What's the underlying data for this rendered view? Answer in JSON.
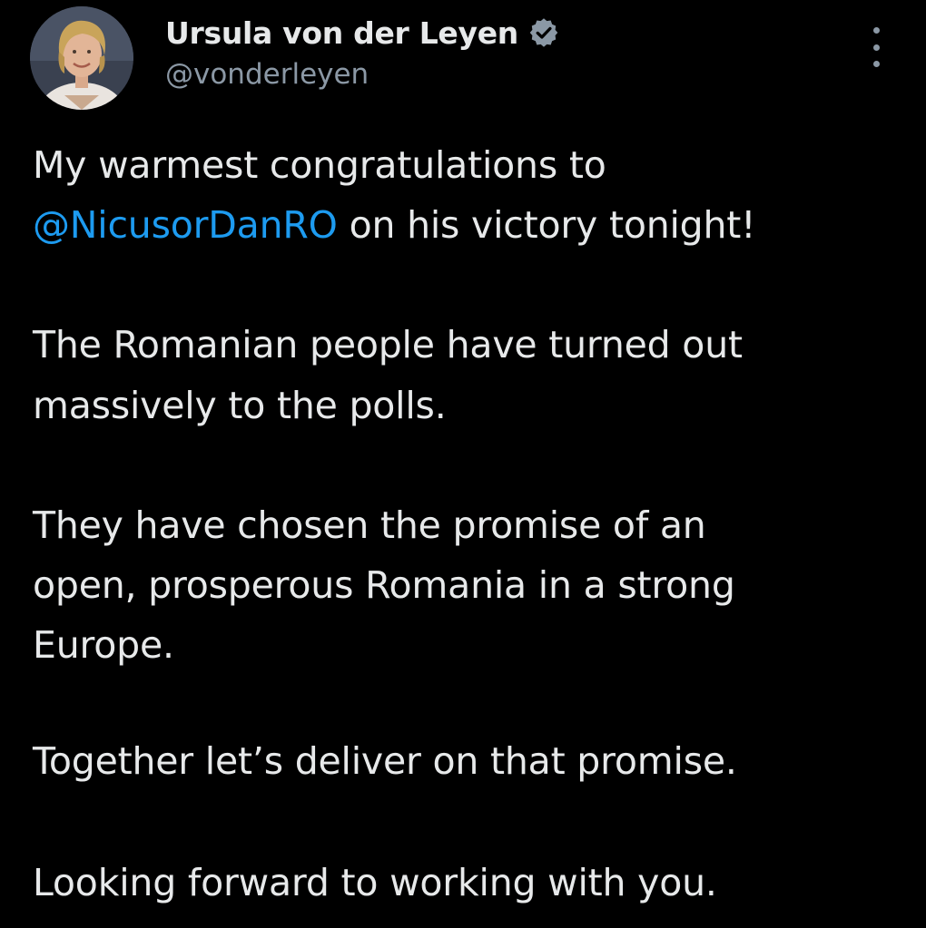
{
  "author": {
    "display_name": "Ursula von der Leyen",
    "handle": "@vonderleyen",
    "verified_icon": "verified-badge-icon",
    "avatar_icon": "profile-photo"
  },
  "menu_icon": "more-options-icon",
  "colors": {
    "background": "#000000",
    "text": "#e7e9ea",
    "secondary_text": "#8b98a5",
    "mention": "#1d9bf0"
  },
  "tweet": {
    "line1": "My warmest congratulations to",
    "mention": "@NicusorDanRO",
    "line2_rest": " on his victory tonight!",
    "line3": "The Romanian people have turned out",
    "line4": "massively to the polls.",
    "line5": "They have chosen the promise of an",
    "line6": "open, prosperous Romania in a strong",
    "line7": "Europe.",
    "line8": "Together let’s deliver on that promise.",
    "line9": "Looking forward to working with you."
  }
}
